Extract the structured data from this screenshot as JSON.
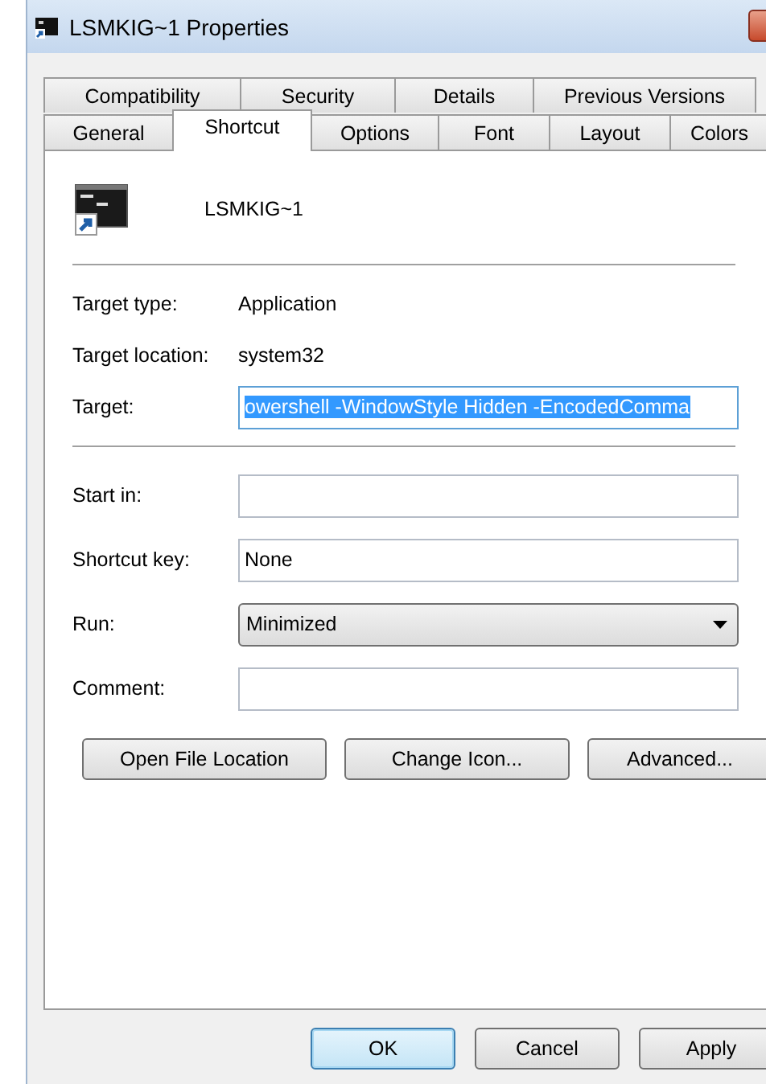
{
  "window": {
    "title": "LSMKIG~1 Properties"
  },
  "tab_rows": [
    [
      {
        "label": "Compatibility",
        "selected": false
      },
      {
        "label": "Security",
        "selected": false
      },
      {
        "label": "Details",
        "selected": false
      },
      {
        "label": "Previous Versions",
        "selected": false
      }
    ],
    [
      {
        "label": "General",
        "selected": false
      },
      {
        "label": "Shortcut",
        "selected": true
      },
      {
        "label": "Options",
        "selected": false
      },
      {
        "label": "Font",
        "selected": false
      },
      {
        "label": "Layout",
        "selected": false
      },
      {
        "label": "Colors",
        "selected": false
      }
    ]
  ],
  "shortcut": {
    "name": "LSMKIG~1"
  },
  "info": [
    {
      "label": "Target type:",
      "value": "Application"
    },
    {
      "label": "Target location:",
      "value": "system32"
    }
  ],
  "target": {
    "label": "Target:",
    "value": "owershell -WindowStyle Hidden -EncodedComma",
    "selected": true
  },
  "fields": [
    {
      "label": "Start in:",
      "kind": "text"
    },
    {
      "label": "Shortcut key:",
      "kind": "text",
      "value": "None"
    },
    {
      "label": "Run:",
      "kind": "dropdown",
      "value": "Minimized"
    },
    {
      "label": "Comment:",
      "kind": "text"
    }
  ],
  "actions": [
    "Open File Location",
    "Change Icon...",
    "Advanced..."
  ],
  "buttons": [
    {
      "label": "OK",
      "default": true
    },
    {
      "label": "Cancel",
      "default": false
    },
    {
      "label": "Apply",
      "default": false
    }
  ]
}
